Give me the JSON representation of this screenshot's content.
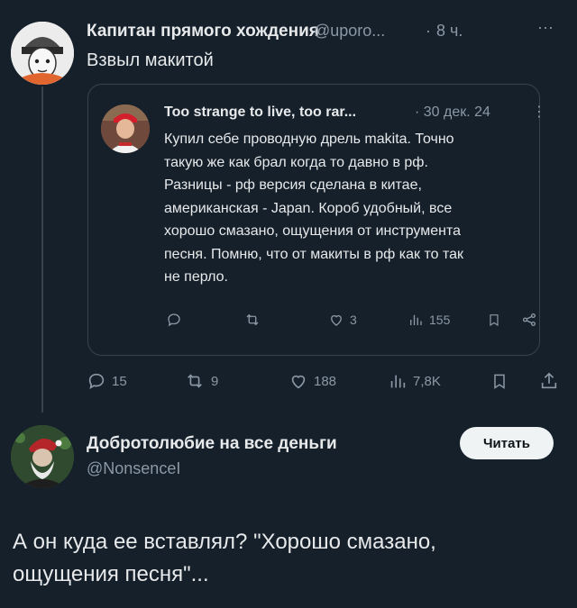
{
  "main_tweet": {
    "author_name": "Капитан прямого хождения",
    "handle": "@uporo...",
    "separator": "·",
    "time": "8 ч.",
    "more": "···",
    "text": "Взвыл макитой",
    "actions": {
      "replies": "15",
      "retweets": "9",
      "likes": "188",
      "views": "7,8K"
    }
  },
  "quoted_tweet": {
    "author_name": "Too strange to live, too rar...",
    "date": "· 30 дек. 24",
    "more": "⋮",
    "lines": [
      "Купил себе проводную дрель makita. Точно",
      "такую же как брал когда то давно в рф.",
      "Разницы - рф версия сделана в китае,",
      "американская - Japan. Короб удобный, все",
      "хорошо смазано, ощущения от инструмента",
      "песня. Помню, что от макиты в рф как то так",
      "не перло."
    ],
    "actions": {
      "likes": "3",
      "views": "155"
    }
  },
  "reply": {
    "author_name": "Добротолюбие на все деньги",
    "handle": "@NonsenceI",
    "button_label": "Читать",
    "line1": "А он куда ее вставлял? \"Хорошо смазано,",
    "line2": "ощущения песня\"..."
  },
  "icons": [
    "reply-icon",
    "retweet-icon",
    "like-icon",
    "views-icon",
    "bookmark-icon",
    "share-icon"
  ],
  "colors": {
    "background": "#15202b",
    "text": "#e7e9ea",
    "muted": "#8b98a5",
    "border": "#38444d"
  }
}
